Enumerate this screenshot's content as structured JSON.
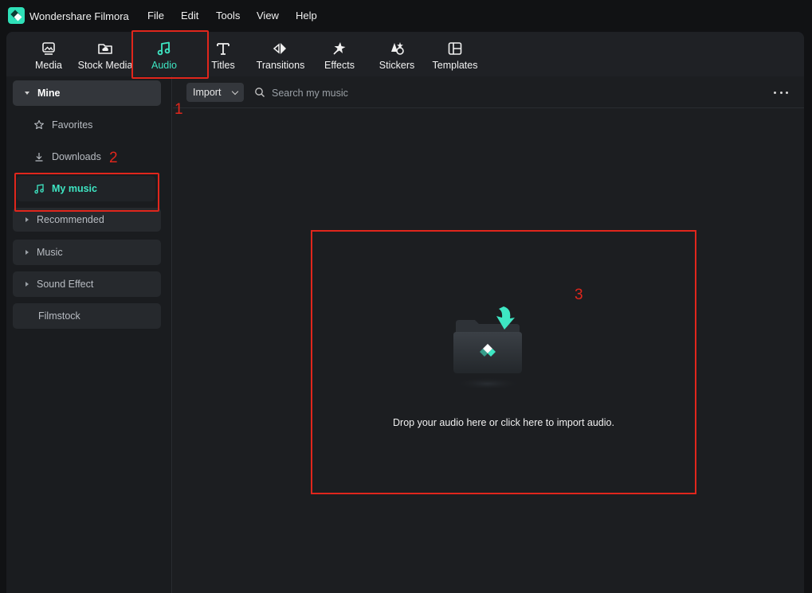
{
  "app": {
    "title": "Wondershare Filmora",
    "menu": [
      "File",
      "Edit",
      "Tools",
      "View",
      "Help"
    ]
  },
  "toolbar": {
    "tabs": [
      {
        "label": "Media",
        "icon": "media-icon"
      },
      {
        "label": "Stock Media",
        "icon": "stock-media-icon"
      },
      {
        "label": "Audio",
        "icon": "music-note-icon",
        "active": true
      },
      {
        "label": "Titles",
        "icon": "titles-icon"
      },
      {
        "label": "Transitions",
        "icon": "transitions-icon"
      },
      {
        "label": "Effects",
        "icon": "effects-icon"
      },
      {
        "label": "Stickers",
        "icon": "stickers-icon"
      },
      {
        "label": "Templates",
        "icon": "templates-icon"
      }
    ]
  },
  "sidebar": {
    "mine": "Mine",
    "favorites": "Favorites",
    "downloads": "Downloads",
    "my_music": "My music",
    "recommended": "Recommended",
    "music": "Music",
    "sound_effect": "Sound Effect",
    "filmstock": "Filmstock"
  },
  "main": {
    "import_label": "Import",
    "search_placeholder": "Search my music",
    "drop_text": "Drop your audio here or click here to import audio."
  },
  "annotations": [
    "1",
    "2",
    "3"
  ],
  "colors": {
    "accent": "#3ee6c3",
    "annotation": "#e0261c",
    "background": "#1c1e21"
  }
}
